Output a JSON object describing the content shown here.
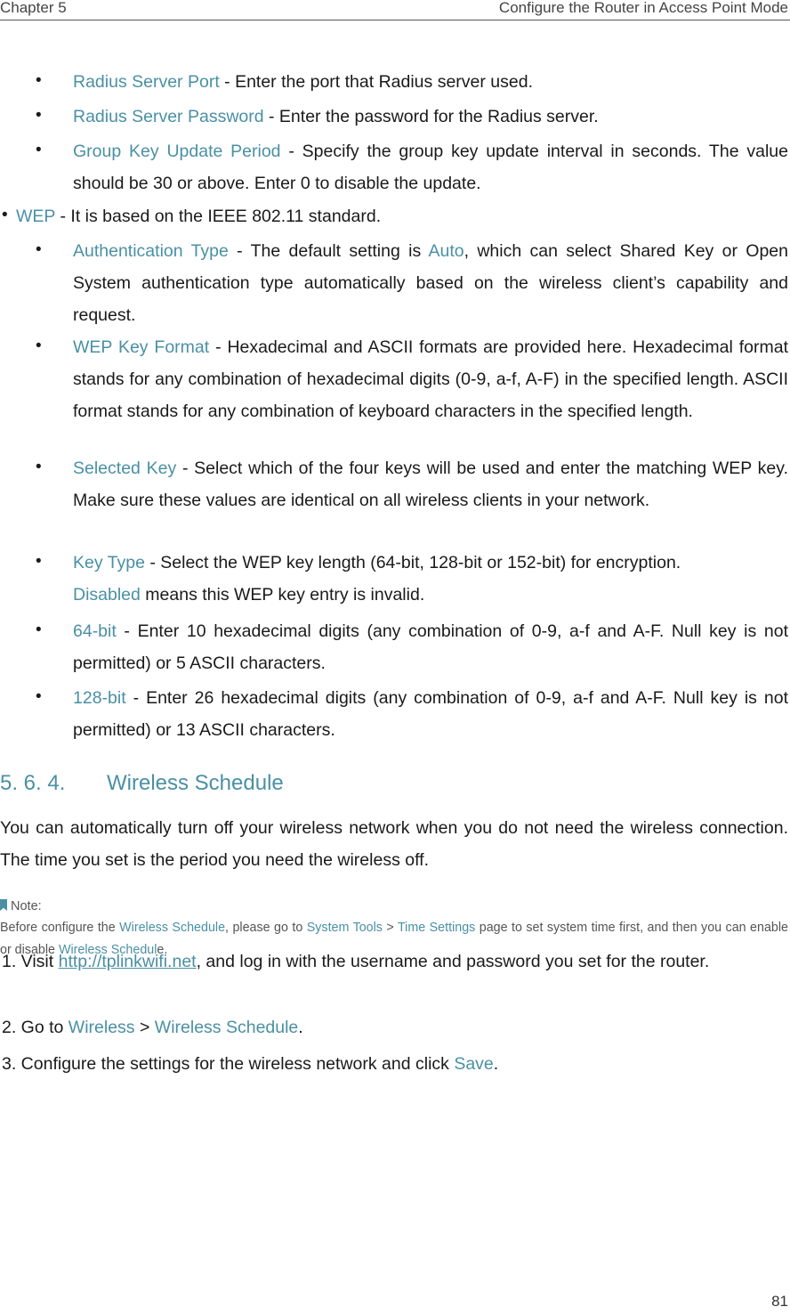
{
  "header": {
    "chapter": "Chapter 5",
    "title": "Configure the Router in Access Point Mode"
  },
  "items": [
    {
      "term": "Radius Server Port",
      "text": " - Enter the port that Radius server used."
    },
    {
      "term": "Radius Server Password",
      "text": " - Enter the password for the Radius server."
    },
    {
      "term": "Group Key Update Period",
      "text": " - Specify the group key update interval in seconds. The value should be 30 or above. Enter 0 to disable the update."
    },
    {
      "term": "WEP",
      "text": " - It is based on the IEEE 802.11 standard."
    },
    {
      "term": "Authentication Type",
      "text1": " - The default setting is ",
      "term2": "Auto",
      "text2": ", which can select Shared Key or Open System authentication type automatically based on the wireless client’s capability and request."
    },
    {
      "term": "WEP Key Format",
      "text": " - Hexadecimal and ASCII formats are provided here. Hexadecimal format stands for any combination of hexadecimal digits (0-9, a-f, A-F) in the specified length. ASCII format stands for any combination of keyboard characters in the specified length."
    },
    {
      "term": "Selected Key",
      "text": " - Select which of the four keys will be used and enter the matching WEP key. Make sure these values are identical on all wireless clients in your network."
    },
    {
      "term": "Key Type",
      "text": " - Select the WEP key length (64-bit, 128-bit or 152-bit) for encryption.",
      "term2": "Disabled",
      "text2": " means this WEP key entry is invalid."
    },
    {
      "term": "64-bit",
      "text": " - Enter 10 hexadecimal digits (any combination of 0-9, a-f and A-F. Null key is not permitted) or 5 ASCII characters."
    },
    {
      "term": "128-bit",
      "text": " - Enter 26 hexadecimal digits (any combination of 0-9, a-f and A-F. Null key is not permitted) or 13 ASCII characters."
    }
  ],
  "section": {
    "number": "5. 6. 4.",
    "title": "Wireless Schedule",
    "intro": "You can automatically turn off your wireless network when you do not need the wireless connection. The time you set is the period you need the wireless off."
  },
  "note": {
    "label": "Note:",
    "t1": "Before configure the ",
    "l1": "Wireless Schedule",
    "t2": ", please go to ",
    "l2": "System Tools",
    "t3": " > ",
    "l3": "Time Settings",
    "t4": " page to set system time first, and then you can enable or disable ",
    "l4": "Wireless Schedul",
    "t5": "e."
  },
  "steps": [
    {
      "n": "1. Visit ",
      "link": "http://tplinkwifi.net",
      "rest": ", and log in with the username and password you set for the router."
    },
    {
      "n": "2. Go to ",
      "a": "Wireless",
      "sep": " > ",
      "b": "Wireless Schedule",
      "end": "."
    },
    {
      "n": "3. Configure the settings for the wireless network and click ",
      "a": "Save",
      "end": "."
    }
  ],
  "page_number": "81"
}
